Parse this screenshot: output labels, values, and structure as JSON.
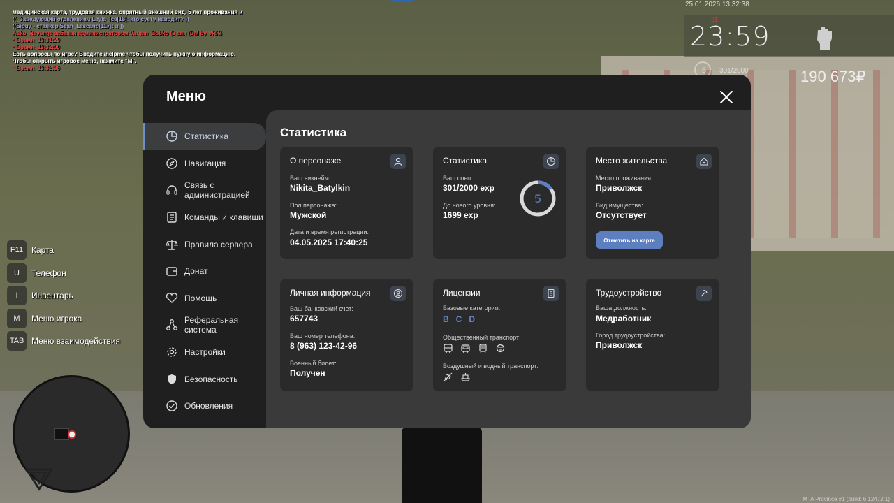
{
  "chat": [
    {
      "text": "медицинская карта, трудовая книжка, опрятный внешний вид, 5 лет проживания и возраст от 18-ти лет.",
      "color": "#ffffff"
    },
    {
      "text": "((_Заведующий отделением Leyla_Ice[18]: кто суету наводит? ))",
      "color": "#9a9cd0"
    },
    {
      "text": "((Sipuy - сталкер Sean_Lascano[117]: и ))",
      "color": "#9a9cd0"
    },
    {
      "text": "Asko_Revenge забанен администратором Varlam_Bobko (3 ая.) (DM by VRK)",
      "color": "#e04040"
    },
    {
      "text": "* Время: 13:31:29",
      "color": "#e04040"
    },
    {
      "text": "* Время: 13:32:00",
      "color": "#e04040"
    },
    {
      "text": "Есть вопросы по игре? Введите /helpme чтобы получить нужную информацию.",
      "color": "#ffffff"
    },
    {
      "text": "Чтобы открыть игровое меню, нажмите \"M\".",
      "color": "#ffffff"
    },
    {
      "text": "* Время: 13:32:36",
      "color": "#e04040"
    }
  ],
  "hud": {
    "date": "25.01.2026 13:32:38",
    "clock": "23:59",
    "clock_small": "21",
    "level": "5",
    "exp": "301/2000",
    "money": "190 673₽"
  },
  "hints": [
    {
      "key": "F11",
      "label": "Карта"
    },
    {
      "key": "U",
      "label": "Телефон"
    },
    {
      "key": "I",
      "label": "Инвентарь"
    },
    {
      "key": "M",
      "label": "Меню игрока"
    },
    {
      "key": "TAB",
      "label": "Меню взаимодействия"
    }
  ],
  "footer": "MTA Province #1 (build: 6.12472.1)",
  "menu": {
    "title": "Меню",
    "sidebar": [
      {
        "label": "Статистика",
        "icon": "pie-chart-icon",
        "active": true
      },
      {
        "label": "Навигация",
        "icon": "compass-icon"
      },
      {
        "label": "Связь с администрацией",
        "icon": "headset-icon"
      },
      {
        "label": "Команды и клавиши",
        "icon": "document-icon"
      },
      {
        "label": "Правила сервера",
        "icon": "scales-icon"
      },
      {
        "label": "Донат",
        "icon": "wallet-icon"
      },
      {
        "label": "Помощь",
        "icon": "heart-handshake-icon"
      },
      {
        "label": "Реферальная система",
        "icon": "network-icon"
      },
      {
        "label": "Настройки",
        "icon": "gear-icon"
      },
      {
        "label": "Безопасность",
        "icon": "shield-icon"
      },
      {
        "label": "Обновления",
        "icon": "check-circle-icon"
      }
    ],
    "content_title": "Статистика",
    "cards": {
      "character": {
        "title": "О персонаже",
        "nickname_label": "Ваш никнейм:",
        "nickname": "Nikita_Batylkin",
        "gender_label": "Пол персонажа:",
        "gender": "Мужской",
        "reg_label": "Дата и время регистрации:",
        "reg": "04.05.2025 17:40:25"
      },
      "stats": {
        "title": "Статистика",
        "exp_label": "Ваш опыт:",
        "exp": "301/2000 exp",
        "next_label": "До нового уровня:",
        "next": "1699 exp",
        "level": "5",
        "level_progress": 0.1505
      },
      "residence": {
        "title": "Место жительства",
        "place_label": "Место проживания:",
        "place": "Приволжск",
        "property_label": "Вид имущества:",
        "property": "Отсутствует",
        "button": "Отметить на карте"
      },
      "personal": {
        "title": "Личная информация",
        "bank_label": "Ваш банковский счет:",
        "bank": "657743",
        "phone_label": "Ваш номер телефона:",
        "phone": "8 (963) 123-42-96",
        "military_label": "Военный билет:",
        "military": "Получен"
      },
      "licenses": {
        "title": "Лицензии",
        "basic_label": "Базовые категории:",
        "categories": [
          "B",
          "C",
          "D"
        ],
        "public_label": "Общественный транспорт:",
        "air_label": "Воздушный и водный транспорт:"
      },
      "employment": {
        "title": "Трудоустройство",
        "position_label": "Ваша должность:",
        "position": "Медработник",
        "city_label": "Город трудоустройства:",
        "city": "Приволжск"
      }
    }
  },
  "colors": {
    "accent": "#5d7fc0",
    "panel": "#1f1f1f",
    "content": "#3a3a3a",
    "card": "#2a2a2a"
  }
}
